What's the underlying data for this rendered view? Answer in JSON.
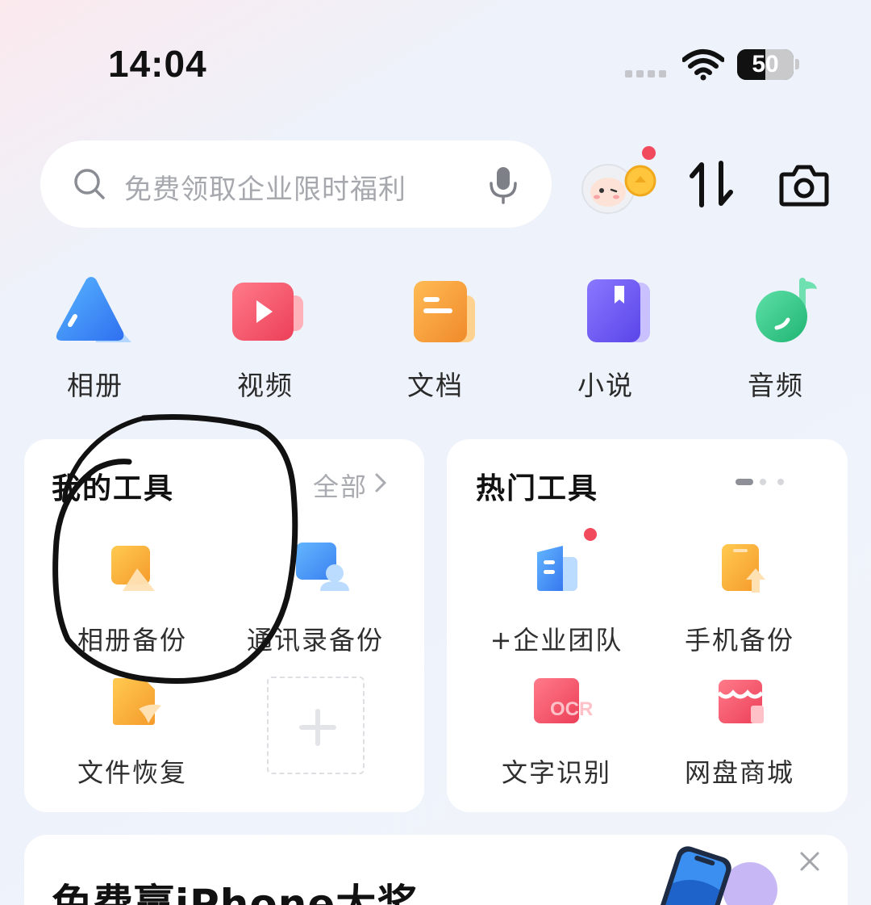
{
  "status_bar": {
    "time": "14:04",
    "battery": "50"
  },
  "search": {
    "placeholder": "免费领取企业限时福利"
  },
  "categories": [
    {
      "label": "相册",
      "icon": "photo-icon"
    },
    {
      "label": "视频",
      "icon": "video-icon"
    },
    {
      "label": "文档",
      "icon": "document-icon"
    },
    {
      "label": "小说",
      "icon": "novel-icon"
    },
    {
      "label": "音频",
      "icon": "audio-icon"
    }
  ],
  "my_tools": {
    "title": "我的工具",
    "all_label": "全部",
    "items": [
      {
        "label": "相册备份",
        "icon": "album-backup-icon"
      },
      {
        "label": "通讯录备份",
        "icon": "contacts-backup-icon"
      },
      {
        "label": "文件恢复",
        "icon": "file-restore-icon"
      }
    ]
  },
  "hot_tools": {
    "title": "热门工具",
    "items": [
      {
        "label": "+企业团队",
        "icon": "enterprise-team-icon"
      },
      {
        "label": "手机备份",
        "icon": "phone-backup-icon"
      },
      {
        "label": "文字识别",
        "icon": "ocr-icon",
        "icon_text": "OCR"
      },
      {
        "label": "网盘商城",
        "icon": "store-icon"
      }
    ]
  },
  "banner": {
    "title": "免费赢iPhone大奖"
  },
  "colors": {
    "accent_red": "#f24a5d",
    "photo_blue": "#3d8cf5",
    "video_red": "#f0556a",
    "doc_orange": "#f49a3a",
    "novel_purple": "#6f5cf0",
    "audio_green": "#33c48a"
  }
}
